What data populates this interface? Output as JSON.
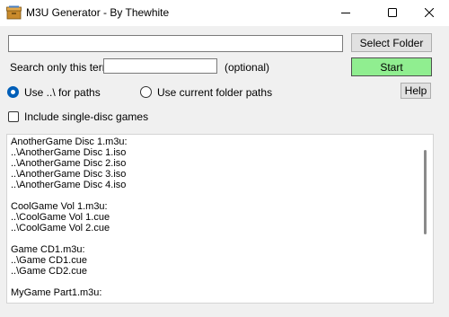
{
  "window": {
    "title": "M3U Generator - By Thewhite",
    "controls": {
      "minimize": "–",
      "maximize": "☐",
      "close": "✕"
    },
    "icons": {
      "app": "archive-box-icon",
      "minimize": "minimize-icon",
      "maximize": "maximize-icon",
      "close": "close-icon"
    }
  },
  "folder": {
    "path_value": "",
    "select_button": "Select Folder"
  },
  "search": {
    "label": "Search only this term:",
    "value": "",
    "hint": "(optional)"
  },
  "start_button": {
    "label": "Start",
    "color": "#90ee90"
  },
  "path_mode": {
    "options": [
      {
        "label": "Use ..\\ for paths",
        "checked": true
      },
      {
        "label": "Use current folder paths",
        "checked": false
      }
    ],
    "accent_color": "#005fb8"
  },
  "help_button": "Help",
  "include_single_disc": {
    "label": "Include single-disc games",
    "checked": false
  },
  "output": {
    "lines": [
      "AnotherGame Disc 1.m3u:",
      "..\\AnotherGame Disc 1.iso",
      "..\\AnotherGame Disc 2.iso",
      "..\\AnotherGame Disc 3.iso",
      "..\\AnotherGame Disc 4.iso",
      "",
      "CoolGame Vol 1.m3u:",
      "..\\CoolGame Vol 1.cue",
      "..\\CoolGame Vol 2.cue",
      "",
      "Game CD1.m3u:",
      "..\\Game CD1.cue",
      "..\\Game CD2.cue",
      "",
      "MyGame Part1.m3u:"
    ]
  }
}
